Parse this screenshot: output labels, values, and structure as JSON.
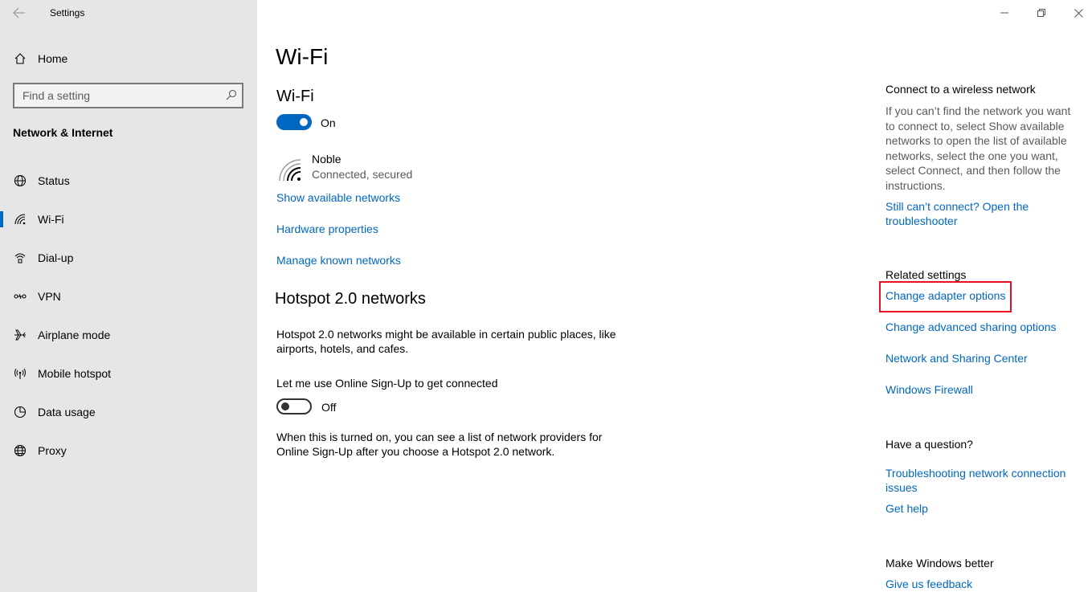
{
  "window": {
    "title": "Settings"
  },
  "sidebar": {
    "home_label": "Home",
    "search_placeholder": "Find a setting",
    "section_title": "Network & Internet",
    "items": [
      {
        "label": "Status",
        "icon": "globe-status-icon"
      },
      {
        "label": "Wi-Fi",
        "icon": "wifi-icon",
        "selected": true
      },
      {
        "label": "Dial-up",
        "icon": "dialup-icon"
      },
      {
        "label": "VPN",
        "icon": "vpn-icon"
      },
      {
        "label": "Airplane mode",
        "icon": "airplane-icon"
      },
      {
        "label": "Mobile hotspot",
        "icon": "hotspot-icon"
      },
      {
        "label": "Data usage",
        "icon": "data-usage-icon"
      },
      {
        "label": "Proxy",
        "icon": "globe-icon"
      }
    ]
  },
  "main": {
    "page_title": "Wi-Fi",
    "wifi_heading": "Wi-Fi",
    "wifi_toggle": {
      "state": "On",
      "on": true
    },
    "network": {
      "name": "Noble",
      "status": "Connected, secured"
    },
    "links": [
      "Show available networks",
      "Hardware properties",
      "Manage known networks"
    ],
    "hotspot_heading": "Hotspot 2.0 networks",
    "hotspot_desc": "Hotspot 2.0 networks might be available in certain public places, like airports, hotels, and cafes.",
    "signup_label": "Let me use Online Sign-Up to get connected",
    "signup_toggle": {
      "state": "Off",
      "on": false
    },
    "signup_desc": "When this is turned on, you can see a list of network providers for Online Sign-Up after you choose a Hotspot 2.0 network."
  },
  "right_panel": {
    "connect_heading": "Connect to a wireless network",
    "connect_desc": "If you can’t find the network you want to connect to, select Show available networks to open the list of available networks, select the one you want, select Connect, and then follow the instructions.",
    "troubleshooter_link": "Still can’t connect? Open the troubleshooter",
    "related_heading": "Related settings",
    "related_links": [
      "Change adapter options",
      "Change advanced sharing options",
      "Network and Sharing Center",
      "Windows Firewall"
    ],
    "question_heading": "Have a question?",
    "question_links": [
      "Troubleshooting network connection issues",
      "Get help"
    ],
    "better_heading": "Make Windows better",
    "feedback_link": "Give us feedback"
  },
  "colors": {
    "accent": "#0067c0",
    "sidebar_bg": "#e6e6e6",
    "highlight": "#e81123"
  }
}
